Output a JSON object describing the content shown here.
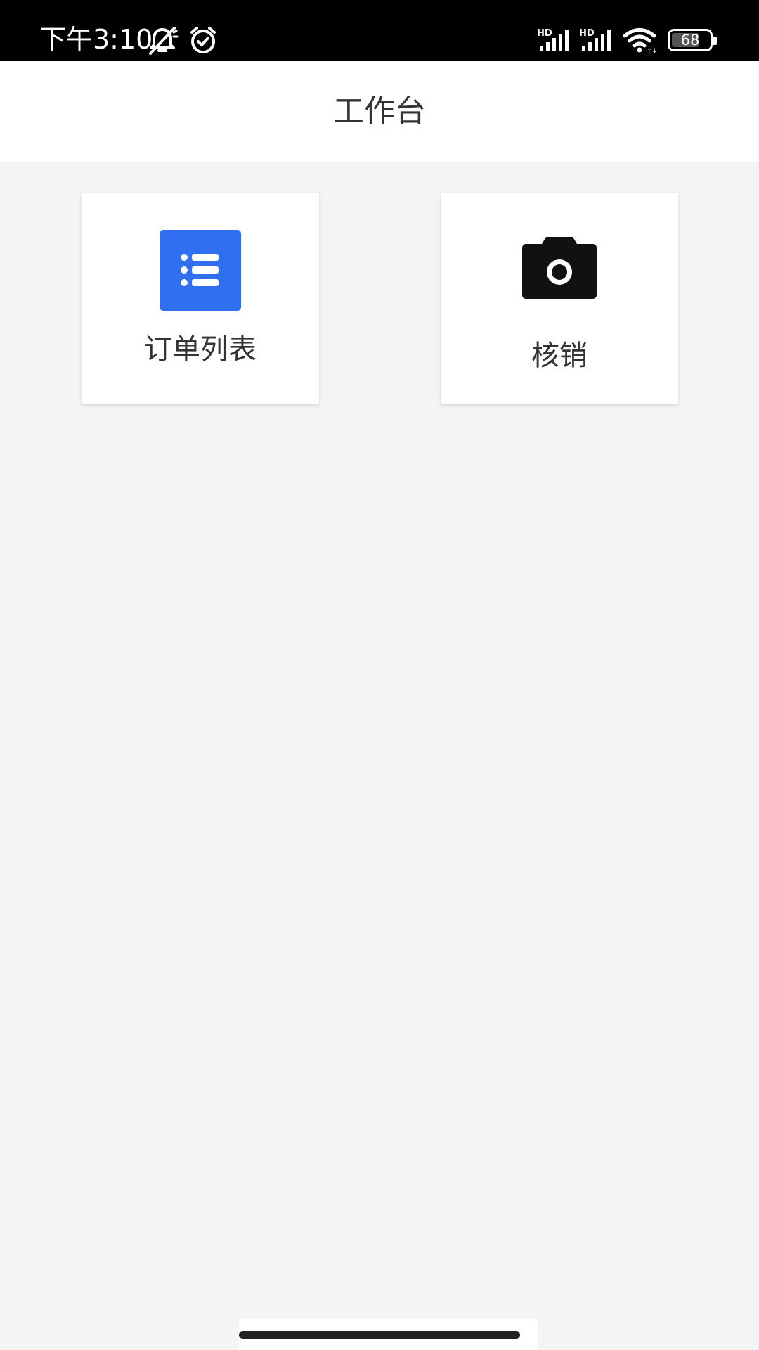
{
  "status_bar": {
    "time": "下午3:10",
    "battery_level": "68",
    "icons": [
      "mute-icon",
      "alarm-icon",
      "signal-hd-icon",
      "signal-hd-icon",
      "wifi-icon",
      "battery-icon"
    ]
  },
  "header": {
    "title": "工作台"
  },
  "tiles": [
    {
      "label": "订单列表",
      "icon": "list-icon",
      "icon_color": "#3070f0"
    },
    {
      "label": "核销",
      "icon": "camera-icon",
      "icon_color": "#111111"
    }
  ],
  "colors": {
    "background": "#f4f4f4",
    "header_background": "#ffffff",
    "accent": "#3070f0",
    "text": "#333333"
  }
}
